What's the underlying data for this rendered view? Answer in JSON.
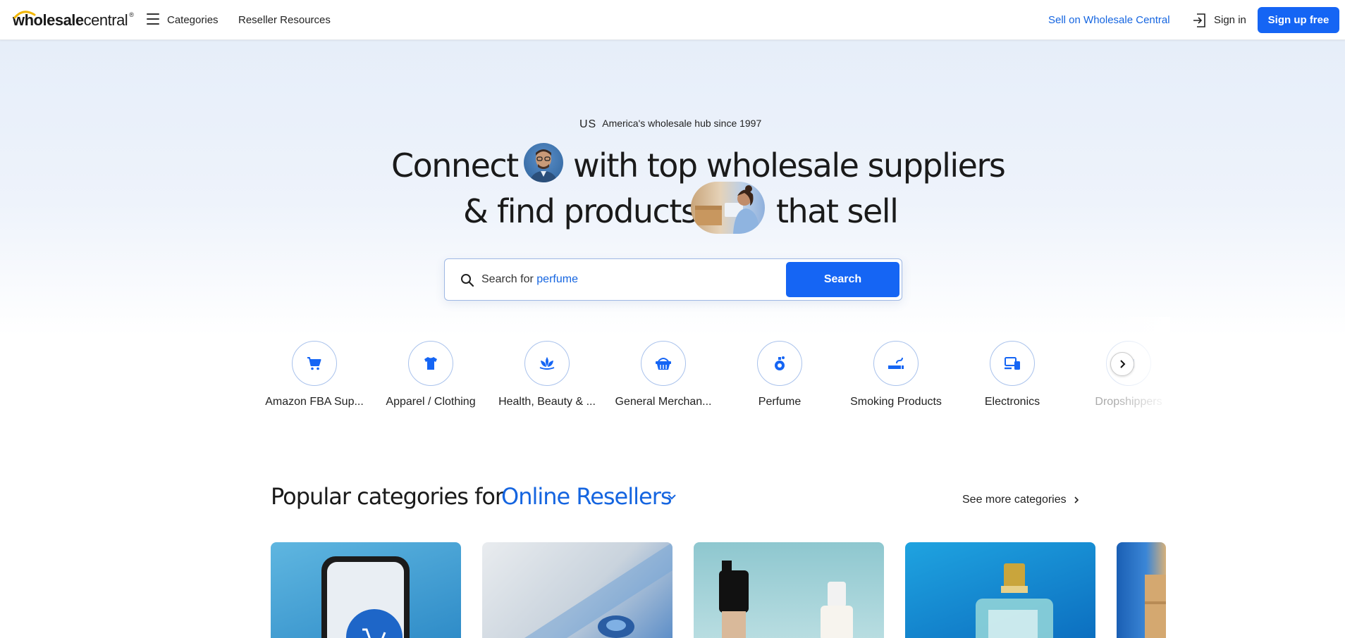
{
  "header": {
    "logo_bold": "wholesale",
    "logo_reg": "central",
    "logo_tm": "®",
    "nav": [
      "Categories",
      "Reseller Resources"
    ],
    "sell_link": "Sell on Wholesale Central",
    "signin": "Sign in",
    "signup": "Sign up free"
  },
  "hero": {
    "flag": "US",
    "tagline": "America's wholesale hub since 1997",
    "line1_a": "Connect",
    "line1_b": "with top wholesale suppliers",
    "line2_a": "&",
    "line2_b": "find products",
    "line2_c": "that sell"
  },
  "search": {
    "prefix": "Search for ",
    "example": "perfume",
    "button": "Search"
  },
  "categories": [
    {
      "label": "Amazon FBA Sup...",
      "icon": "cart-icon"
    },
    {
      "label": "Apparel / Clothing",
      "icon": "tshirt-icon"
    },
    {
      "label": "Health, Beauty & ...",
      "icon": "lotus-icon"
    },
    {
      "label": "General Merchan...",
      "icon": "basket-icon"
    },
    {
      "label": "Perfume",
      "icon": "perfume-bottle-icon"
    },
    {
      "label": "Smoking Products",
      "icon": "smoking-icon"
    },
    {
      "label": "Electronics",
      "icon": "devices-icon"
    },
    {
      "label": "Dropshippers",
      "icon": "dropship-icon"
    }
  ],
  "popular": {
    "title": "Popular categories for",
    "segment": "Online Resellers",
    "see_more": "See more categories"
  },
  "colors": {
    "accent": "#1565f4",
    "link": "#1565e0"
  }
}
